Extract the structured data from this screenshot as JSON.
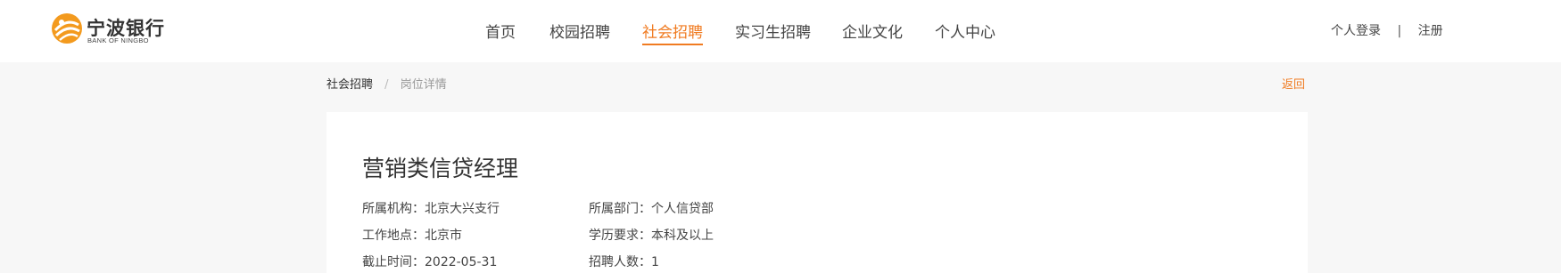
{
  "header": {
    "logo_cn": "宁波银行",
    "logo_en": "BANK OF NINGBO",
    "nav": [
      {
        "label": "首页"
      },
      {
        "label": "校园招聘"
      },
      {
        "label": "社会招聘",
        "active": true
      },
      {
        "label": "实习生招聘"
      },
      {
        "label": "企业文化"
      },
      {
        "label": "个人中心"
      }
    ],
    "login_label": "个人登录",
    "separator": "|",
    "register_label": "注册"
  },
  "breadcrumb": {
    "root": "社会招聘",
    "slash": "/",
    "current": "岗位详情"
  },
  "back_label": "返回",
  "job": {
    "title": "营销类信贷经理",
    "fields": [
      {
        "key": "所属机构：",
        "value": "北京大兴支行"
      },
      {
        "key": "所属部门：",
        "value": "个人信贷部"
      },
      {
        "key": "工作地点：",
        "value": "北京市"
      },
      {
        "key": "学历要求：",
        "value": "本科及以上"
      },
      {
        "key": "截止时间：",
        "value": "2022-05-31"
      },
      {
        "key": "招聘人数：",
        "value": "1"
      }
    ]
  },
  "colors": {
    "accent": "#f07b21",
    "page_bg": "#f7f7f7",
    "card_bg": "#ffffff"
  }
}
